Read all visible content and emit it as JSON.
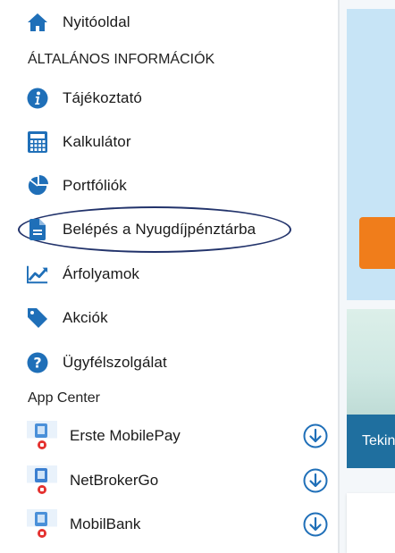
{
  "menu": {
    "home": {
      "label": "Nyitóoldal",
      "icon": "home-icon"
    },
    "general_section": "ÁLTALÁNOS INFORMÁCIÓK",
    "items": [
      {
        "label": "Tájékoztató",
        "icon": "info-icon"
      },
      {
        "label": "Kalkulátor",
        "icon": "calculator-icon"
      },
      {
        "label": "Portfóliók",
        "icon": "pie-chart-icon"
      },
      {
        "label": "Belépés a Nyugdíjpénztárba",
        "icon": "document-icon"
      },
      {
        "label": "Árfolyamok",
        "icon": "line-chart-icon"
      },
      {
        "label": "Akciók",
        "icon": "tag-icon"
      },
      {
        "label": "Ügyfélszolgálat",
        "icon": "help-icon"
      }
    ],
    "app_center_title": "App Center",
    "apps": [
      {
        "label": "Erste MobilePay",
        "icon": "erste-mobilepay-icon",
        "action_icon": "download-icon"
      },
      {
        "label": "NetBrokerGo",
        "icon": "netbrokergo-icon",
        "action_icon": "download-icon"
      },
      {
        "label": "MobilBank",
        "icon": "mobilbank-icon",
        "action_icon": "download-icon"
      }
    ]
  },
  "background": {
    "banner_text": "Tekin"
  },
  "colors": {
    "icon_blue": "#1f6fb8",
    "accent_orange": "#f07d1b",
    "highlight_ellipse": "#22336b"
  }
}
